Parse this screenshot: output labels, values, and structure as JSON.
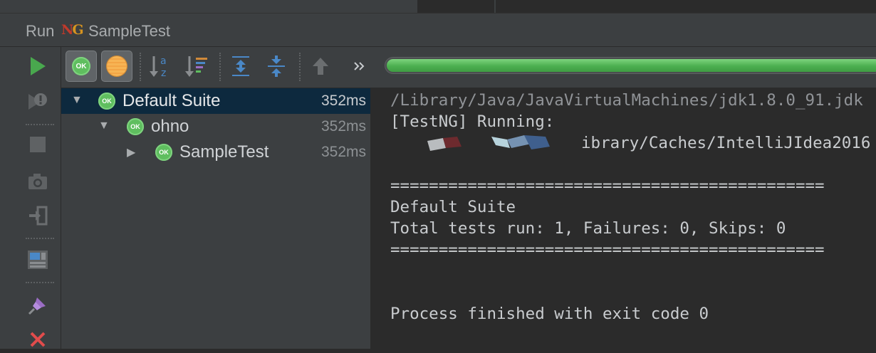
{
  "window": {
    "tool_window_label": "Run",
    "run_config_name": "SampleTest"
  },
  "toolbar": {
    "icons": [
      "show-passed-icon",
      "show-ignored-icon",
      "sort-alpha-icon",
      "sort-duration-icon",
      "expand-all-icon",
      "collapse-all-icon",
      "previous-failed-icon",
      "more-icon"
    ],
    "progress_fraction": 1.0
  },
  "left_toolbar": {
    "icons": [
      "rerun-icon",
      "rerun-failed-icon",
      "stop-icon",
      "screenshot-icon",
      "export-icon",
      "layout-icon",
      "pin-icon",
      "close-icon"
    ]
  },
  "colors": {
    "ok_badge": "#5fbe5f",
    "progress": "#4caf50",
    "selection": "#0d293e",
    "close": "#e24c4c"
  },
  "tree": {
    "badge_text": "OK",
    "items": [
      {
        "name": "Default Suite",
        "time": "352ms",
        "expanded": true,
        "selected": true
      },
      {
        "name": "ohno",
        "time": "352ms",
        "expanded": true
      },
      {
        "name": "SampleTest",
        "time": "352ms",
        "expanded": false
      }
    ]
  },
  "console": {
    "lines": [
      "/Library/Java/JavaVirtualMachines/jdk1.8.0_91.jdk",
      "[TestNG] Running:",
      "ibrary/Caches/IntelliJIdea2016",
      "=============================================",
      "Default Suite",
      "Total tests run: 1, Failures: 0, Skips: 0",
      "=============================================",
      "Process finished with exit code 0"
    ]
  }
}
